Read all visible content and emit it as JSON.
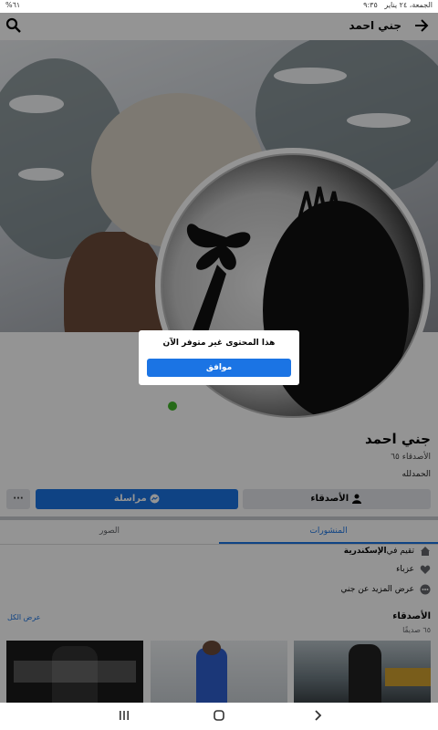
{
  "status_bar": {
    "time": "٩:٣٥",
    "date": "الجمعة، ٢٤ يناير",
    "battery": "%٦١"
  },
  "header": {
    "title": "جني احمد",
    "back_icon": "arrow-right-icon",
    "search_icon": "search-icon"
  },
  "dialog": {
    "message": "هذا المحتوى غير متوفر الآن",
    "ok_label": "موافق"
  },
  "profile": {
    "name": "جني احمد",
    "friends_count": "الأصدقاء ٦٥",
    "bio": "الحمدلله",
    "online_color": "#42b72a"
  },
  "actions": {
    "friends_label": "الأصدقاء",
    "message_label": "مراسلة",
    "more_label": "···"
  },
  "tabs": [
    {
      "label": "المنشورات",
      "active": true
    },
    {
      "label": "الصور",
      "active": false
    }
  ],
  "details": [
    {
      "icon": "home-icon",
      "prefix": "تقيم في ",
      "text": "الإسكندرية"
    },
    {
      "icon": "heart-icon",
      "prefix": "",
      "text": "عزباء"
    },
    {
      "icon": "more-dots-icon",
      "prefix": "",
      "text": "عرض المزيد عن جني"
    }
  ],
  "friends_section": {
    "title": "الأصدقاء",
    "subtitle": "٦٥ صديقًا",
    "see_all": "عرض الكل"
  },
  "colors": {
    "accent": "#1b74e4",
    "button_gray": "#e4e6eb"
  }
}
